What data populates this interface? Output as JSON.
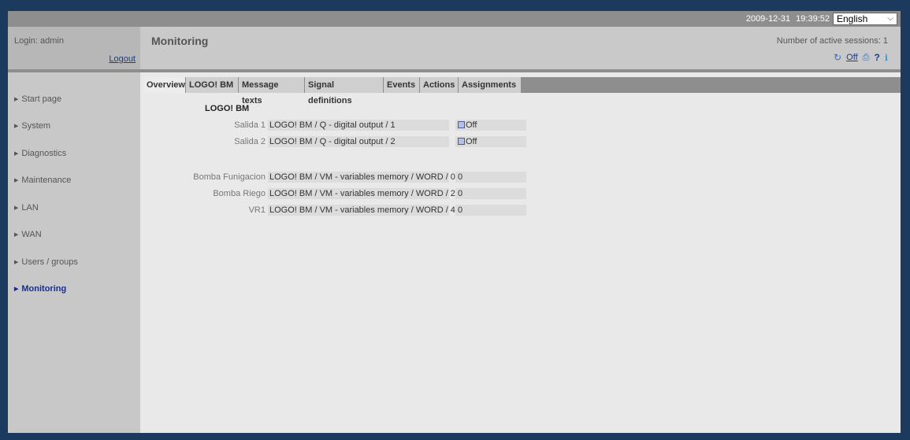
{
  "topbar": {
    "date": "2009-12-31",
    "time": "19:39:52",
    "language": "English"
  },
  "header": {
    "login_label": "Login: admin",
    "logout_label": "Logout",
    "page_title": "Monitoring",
    "sessions_text": "Number of active sessions: 1",
    "auto_refresh_label": "Off"
  },
  "sidebar": {
    "items": [
      {
        "label": "Start page",
        "active": false
      },
      {
        "label": "System",
        "active": false
      },
      {
        "label": "Diagnostics",
        "active": false
      },
      {
        "label": "Maintenance",
        "active": false
      },
      {
        "label": "LAN",
        "active": false
      },
      {
        "label": "WAN",
        "active": false
      },
      {
        "label": "Users / groups",
        "active": false
      },
      {
        "label": "Monitoring",
        "active": true
      }
    ]
  },
  "tabs": [
    {
      "label": "Overview",
      "active": true
    },
    {
      "label": "LOGO! BM",
      "active": false
    },
    {
      "label": "Message texts",
      "active": false
    },
    {
      "label": "Signal definitions",
      "active": false
    },
    {
      "label": "Events",
      "active": false
    },
    {
      "label": "Actions",
      "active": false
    },
    {
      "label": "Assignments",
      "active": false
    }
  ],
  "overview": {
    "group_title": "LOGO! BM",
    "digital_rows": [
      {
        "label": "Salida 1",
        "source": "LOGO! BM / Q - digital output / 1",
        "value": "Off"
      },
      {
        "label": "Salida 2",
        "source": "LOGO! BM / Q - digital output / 2",
        "value": "Off"
      }
    ],
    "memory_rows": [
      {
        "label": "Bomba Funigacion",
        "source": "LOGO! BM / VM - variables memory / WORD / 0",
        "value": "0"
      },
      {
        "label": "Bomba Riego",
        "source": "LOGO! BM / VM - variables memory / WORD / 2",
        "value": "0"
      },
      {
        "label": "VR1",
        "source": "LOGO! BM / VM - variables memory / WORD / 4",
        "value": "0"
      }
    ]
  }
}
